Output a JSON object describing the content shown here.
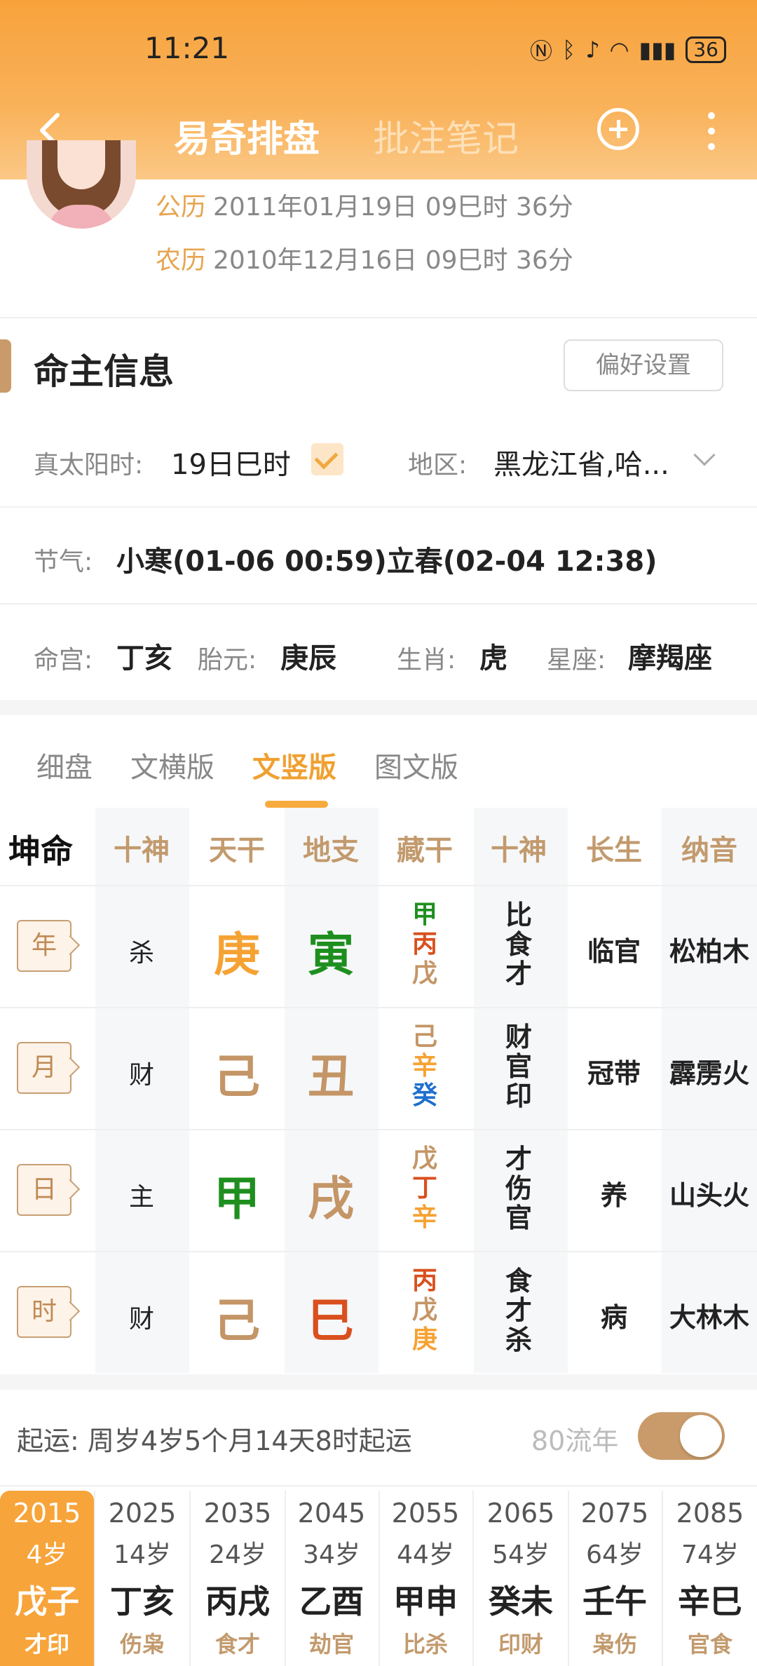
{
  "status": {
    "time": "11:21",
    "battery": "36"
  },
  "nav": {
    "tab_active": "易奇排盘",
    "tab_other": "批注笔记"
  },
  "profile": {
    "gongli_label": "公历",
    "gongli_value": "2011年01月19日 09巳时 36分",
    "nongli_label": "农历",
    "nongli_value": "2010年12月16日 09巳时 36分"
  },
  "section": {
    "title": "命主信息",
    "pref_button": "偏好设置"
  },
  "info": {
    "solar_label": "真太阳时:",
    "solar_value": "19日巳时",
    "region_label": "地区:",
    "region_value": "黑龙江省,哈...",
    "jieqi_label": "节气:",
    "jieqi_value": "小寒(01-06 00:59)立春(02-04 12:38)",
    "minggong_label": "命宫:",
    "minggong_value": "丁亥",
    "taiyuan_label": "胎元:",
    "taiyuan_value": "庚辰",
    "shengxiao_label": "生肖:",
    "shengxiao_value": "虎",
    "xingzuo_label": "星座:",
    "xingzuo_value": "摩羯座"
  },
  "tabs": [
    "细盘",
    "文横版",
    "文竖版",
    "图文版"
  ],
  "table": {
    "corner": "坤命",
    "headers": [
      "十神",
      "天干",
      "地支",
      "藏干",
      "十神",
      "长生",
      "纳音"
    ],
    "rows": [
      {
        "pillar": "年",
        "shishen": "杀",
        "gan": "庚",
        "zhi": "寅",
        "canggan": [
          "甲",
          "丙",
          "戊"
        ],
        "cangshen": [
          "比",
          "食",
          "才"
        ],
        "changsheng": "临官",
        "nayin": "松柏木"
      },
      {
        "pillar": "月",
        "shishen": "财",
        "gan": "己",
        "zhi": "丑",
        "canggan": [
          "己",
          "辛",
          "癸"
        ],
        "cangshen": [
          "财",
          "官",
          "印"
        ],
        "changsheng": "冠带",
        "nayin": "霹雳火"
      },
      {
        "pillar": "日",
        "shishen": "主",
        "gan": "甲",
        "zhi": "戌",
        "canggan": [
          "戊",
          "丁",
          "辛"
        ],
        "cangshen": [
          "才",
          "伤",
          "官"
        ],
        "changsheng": "养",
        "nayin": "山头火"
      },
      {
        "pillar": "时",
        "shishen": "财",
        "gan": "己",
        "zhi": "巳",
        "canggan": [
          "丙",
          "戊",
          "庚"
        ],
        "cangshen": [
          "食",
          "才",
          "杀"
        ],
        "changsheng": "病",
        "nayin": "大林木"
      }
    ]
  },
  "colors": {
    "metal": "#f5a233",
    "earth": "#c49566",
    "wood": "#1e8f1e",
    "fire": "#d9501e",
    "water": "#1f6fce"
  },
  "luck": {
    "start_label": "起运:",
    "start_value": "周岁4岁5个月14天8时起运",
    "flow_label": "80流年",
    "decades": [
      {
        "year": "2015",
        "age": "4岁",
        "gz": "戊子",
        "tags": "才印"
      },
      {
        "year": "2025",
        "age": "14岁",
        "gz": "丁亥",
        "tags": "伤枭"
      },
      {
        "year": "2035",
        "age": "24岁",
        "gz": "丙戌",
        "tags": "食才"
      },
      {
        "year": "2045",
        "age": "34岁",
        "gz": "乙酉",
        "tags": "劫官"
      },
      {
        "year": "2055",
        "age": "44岁",
        "gz": "甲申",
        "tags": "比杀"
      },
      {
        "year": "2065",
        "age": "54岁",
        "gz": "癸未",
        "tags": "印财"
      },
      {
        "year": "2075",
        "age": "64岁",
        "gz": "壬午",
        "tags": "枭伤"
      },
      {
        "year": "2085",
        "age": "74岁",
        "gz": "辛巳",
        "tags": "官食"
      }
    ]
  }
}
